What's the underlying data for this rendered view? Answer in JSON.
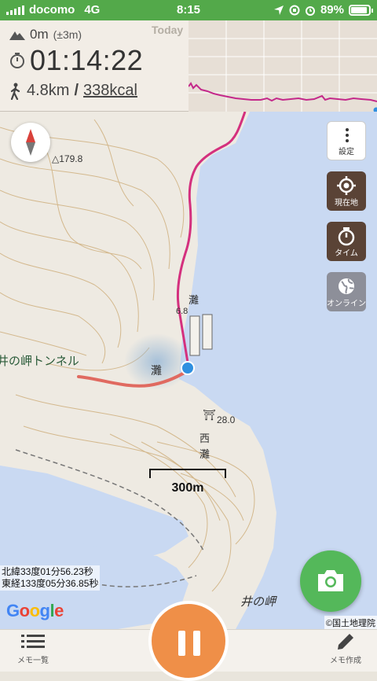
{
  "status_bar": {
    "carrier": "docomo",
    "network": "4G",
    "time": "8:15",
    "battery": "89%",
    "battery_level": 0.89,
    "bar_color": "#53a94a"
  },
  "stats": {
    "altitude": "0m",
    "altitude_accuracy": "(±3m)",
    "elapsed": "01:14:22",
    "distance": "4.8km",
    "separator": "/",
    "calories": "338kcal",
    "graph_label": "Today",
    "icons": [
      "mountain-icon",
      "stopwatch-icon",
      "walker-icon"
    ]
  },
  "map": {
    "labels": {
      "tunnel": "井の岬トンネル",
      "nada": "灘",
      "nada_small": "灘",
      "nishi": "西",
      "nishi_nada": "灘",
      "cape": "井の岬",
      "peak_179": "△179.8",
      "elev_6": "6.8",
      "elev_28": "28.0",
      "shrine": "⛩"
    },
    "scale": "300m",
    "coords": {
      "lat": "北緯33度01分56.23秒",
      "lon": "東経133度05分36.85秒"
    },
    "google": "Google",
    "attribution": "©国土地理院",
    "colors": {
      "track": "#d4307e",
      "tunnel": "#e06a60",
      "sea": "#c9d9f2"
    }
  },
  "side_buttons": {
    "settings": "設定",
    "current_location": "現在地",
    "time": "タイム",
    "online": "オンライン"
  },
  "bottom_bar": {
    "memo_list": "メモ一覧",
    "memo_create": "メモ作成",
    "pause_color": "#ef8f48"
  }
}
